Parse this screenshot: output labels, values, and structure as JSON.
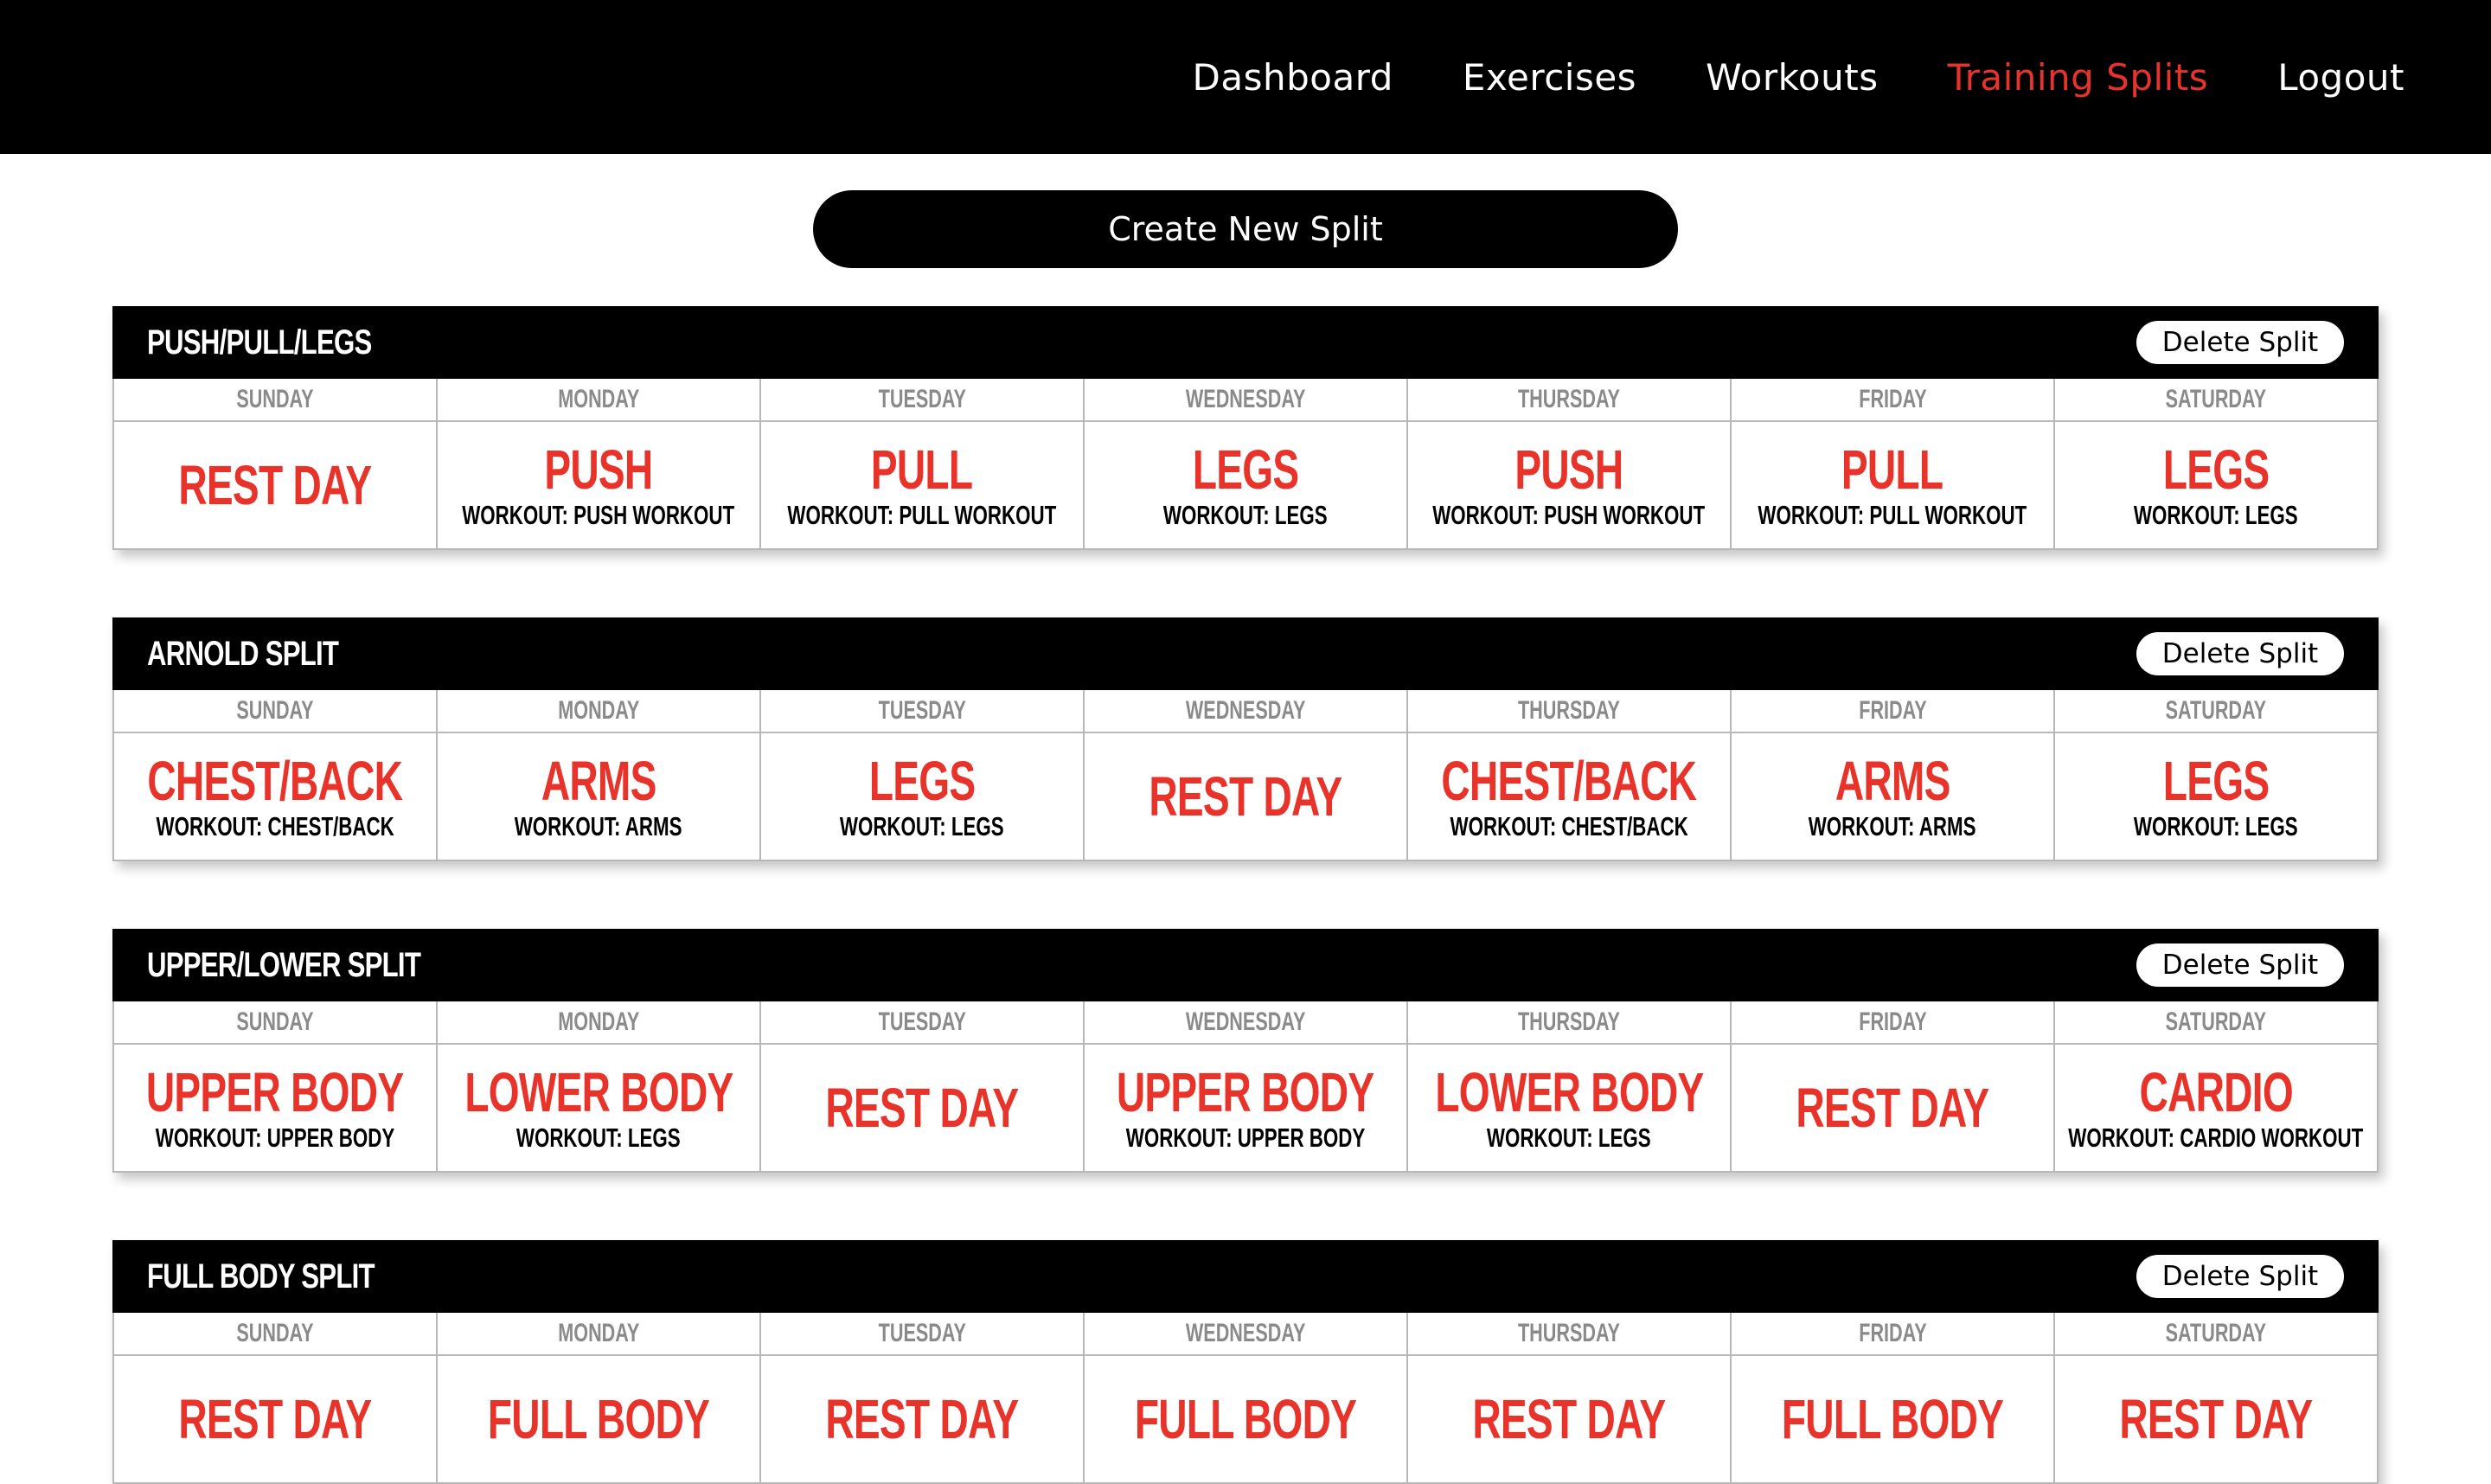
{
  "nav": {
    "links": [
      "Dashboard",
      "Exercises",
      "Workouts",
      "Training Splits",
      "Logout"
    ],
    "active": "Training Splits"
  },
  "create_label": "Create New Split",
  "delete_label": "Delete Split",
  "colors": {
    "accent": "#e8332a",
    "bar": "#000000",
    "day_label": "#8a8a8a"
  },
  "splits": [
    {
      "title": "PUSH/PULL/LEGS",
      "days": [
        {
          "day": "SUNDAY",
          "main": "REST DAY",
          "sub": ""
        },
        {
          "day": "MONDAY",
          "main": "PUSH",
          "sub": "WORKOUT: PUSH WORKOUT"
        },
        {
          "day": "TUESDAY",
          "main": "PULL",
          "sub": "WORKOUT: PULL WORKOUT"
        },
        {
          "day": "WEDNESDAY",
          "main": "LEGS",
          "sub": "WORKOUT: LEGS"
        },
        {
          "day": "THURSDAY",
          "main": "PUSH",
          "sub": "WORKOUT: PUSH WORKOUT"
        },
        {
          "day": "FRIDAY",
          "main": "PULL",
          "sub": "WORKOUT: PULL WORKOUT"
        },
        {
          "day": "SATURDAY",
          "main": "LEGS",
          "sub": "WORKOUT: LEGS"
        }
      ]
    },
    {
      "title": "ARNOLD SPLIT",
      "days": [
        {
          "day": "SUNDAY",
          "main": "CHEST/BACK",
          "sub": "WORKOUT: CHEST/BACK"
        },
        {
          "day": "MONDAY",
          "main": "ARMS",
          "sub": "WORKOUT: ARMS"
        },
        {
          "day": "TUESDAY",
          "main": "LEGS",
          "sub": "WORKOUT: LEGS"
        },
        {
          "day": "WEDNESDAY",
          "main": "REST DAY",
          "sub": ""
        },
        {
          "day": "THURSDAY",
          "main": "CHEST/BACK",
          "sub": "WORKOUT: CHEST/BACK"
        },
        {
          "day": "FRIDAY",
          "main": "ARMS",
          "sub": "WORKOUT: ARMS"
        },
        {
          "day": "SATURDAY",
          "main": "LEGS",
          "sub": "WORKOUT: LEGS"
        }
      ]
    },
    {
      "title": "UPPER/LOWER SPLIT",
      "days": [
        {
          "day": "SUNDAY",
          "main": "UPPER BODY",
          "sub": "WORKOUT: UPPER BODY"
        },
        {
          "day": "MONDAY",
          "main": "LOWER BODY",
          "sub": "WORKOUT: LEGS"
        },
        {
          "day": "TUESDAY",
          "main": "REST DAY",
          "sub": ""
        },
        {
          "day": "WEDNESDAY",
          "main": "UPPER BODY",
          "sub": "WORKOUT: UPPER BODY"
        },
        {
          "day": "THURSDAY",
          "main": "LOWER BODY",
          "sub": "WORKOUT: LEGS"
        },
        {
          "day": "FRIDAY",
          "main": "REST DAY",
          "sub": ""
        },
        {
          "day": "SATURDAY",
          "main": "CARDIO",
          "sub": "WORKOUT: CARDIO WORKOUT"
        }
      ]
    },
    {
      "title": "FULL BODY SPLIT",
      "days": [
        {
          "day": "SUNDAY",
          "main": "REST DAY",
          "sub": ""
        },
        {
          "day": "MONDAY",
          "main": "FULL BODY",
          "sub": ""
        },
        {
          "day": "TUESDAY",
          "main": "REST DAY",
          "sub": ""
        },
        {
          "day": "WEDNESDAY",
          "main": "FULL BODY",
          "sub": ""
        },
        {
          "day": "THURSDAY",
          "main": "REST DAY",
          "sub": ""
        },
        {
          "day": "FRIDAY",
          "main": "FULL BODY",
          "sub": ""
        },
        {
          "day": "SATURDAY",
          "main": "REST DAY",
          "sub": ""
        }
      ]
    }
  ]
}
